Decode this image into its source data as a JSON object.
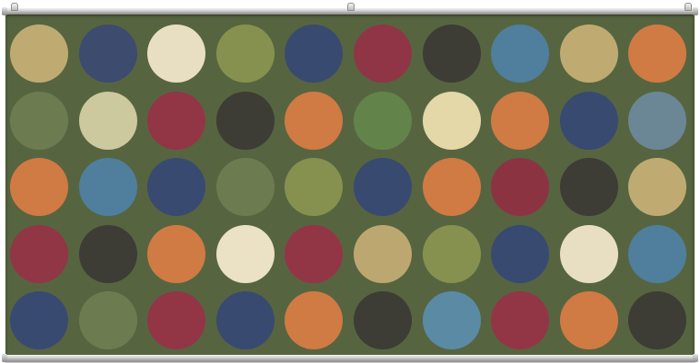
{
  "artwork": {
    "background_color": "#566540",
    "rail_color": "#c4c4c4",
    "dot_rows": [
      [
        "#bfab72",
        "#3d4b6f",
        "#e8dfc3",
        "#86914f",
        "#394a70",
        "#903545",
        "#3d3c35",
        "#4f7f9d",
        "#bfab72",
        "#d07a44"
      ],
      [
        "#6d7c50",
        "#ccc99f",
        "#923646",
        "#3d3c35",
        "#d07a44",
        "#62844a",
        "#e4d7a8",
        "#d07a44",
        "#384a70",
        "#6b8796"
      ],
      [
        "#d07a44",
        "#4f7f9d",
        "#394a70",
        "#6d7c50",
        "#86914f",
        "#394a70",
        "#d07a44",
        "#8c3342",
        "#3d3c35",
        "#bfab72"
      ],
      [
        "#913645",
        "#3d3c35",
        "#d07a44",
        "#ebe1c5",
        "#923646",
        "#bda771",
        "#86914f",
        "#394a70",
        "#e8dfc3",
        "#4f7f9d"
      ],
      [
        "#394a70",
        "#6d7c50",
        "#923646",
        "#394a70",
        "#d07a44",
        "#3d3c35",
        "#5b8aa5",
        "#923646",
        "#d07a44",
        "#3d3c35"
      ]
    ]
  }
}
